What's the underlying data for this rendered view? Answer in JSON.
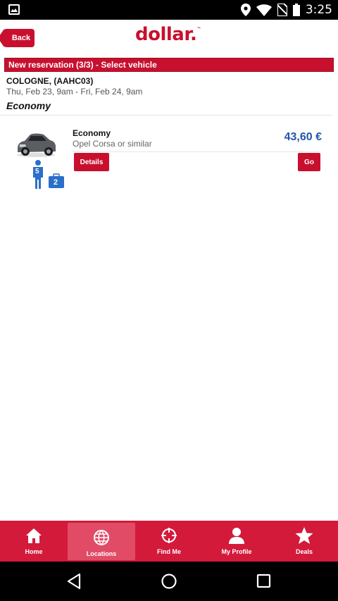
{
  "status_bar": {
    "time": "3:25",
    "icons": [
      "image-icon",
      "location-icon",
      "wifi-icon",
      "no-sim-icon",
      "battery-icon"
    ]
  },
  "header": {
    "back_label": "Back",
    "logo_text": "dollar",
    "logo_mark": "™"
  },
  "reservation": {
    "section_title": "New reservation (3/3) - Select vehicle",
    "location": "COLOGNE,  (AAHC03)",
    "dates": "Thu, Feb 23, 9am - Fri, Feb 24, 9am",
    "category": "Economy"
  },
  "vehicle": {
    "title": "Economy",
    "subtitle": "Opel Corsa or similar",
    "price": "43,60 €",
    "passengers": "5",
    "bags": "2",
    "details_label": "Details",
    "go_label": "Go"
  },
  "bottom_nav": {
    "items": [
      {
        "label": "Home"
      },
      {
        "label": "Locations"
      },
      {
        "label": "Find Me"
      },
      {
        "label": "My Profile"
      },
      {
        "label": "Deals"
      }
    ]
  },
  "colors": {
    "brand": "#c8102e",
    "price": "#2156a5",
    "nav": "#d31a3b"
  }
}
